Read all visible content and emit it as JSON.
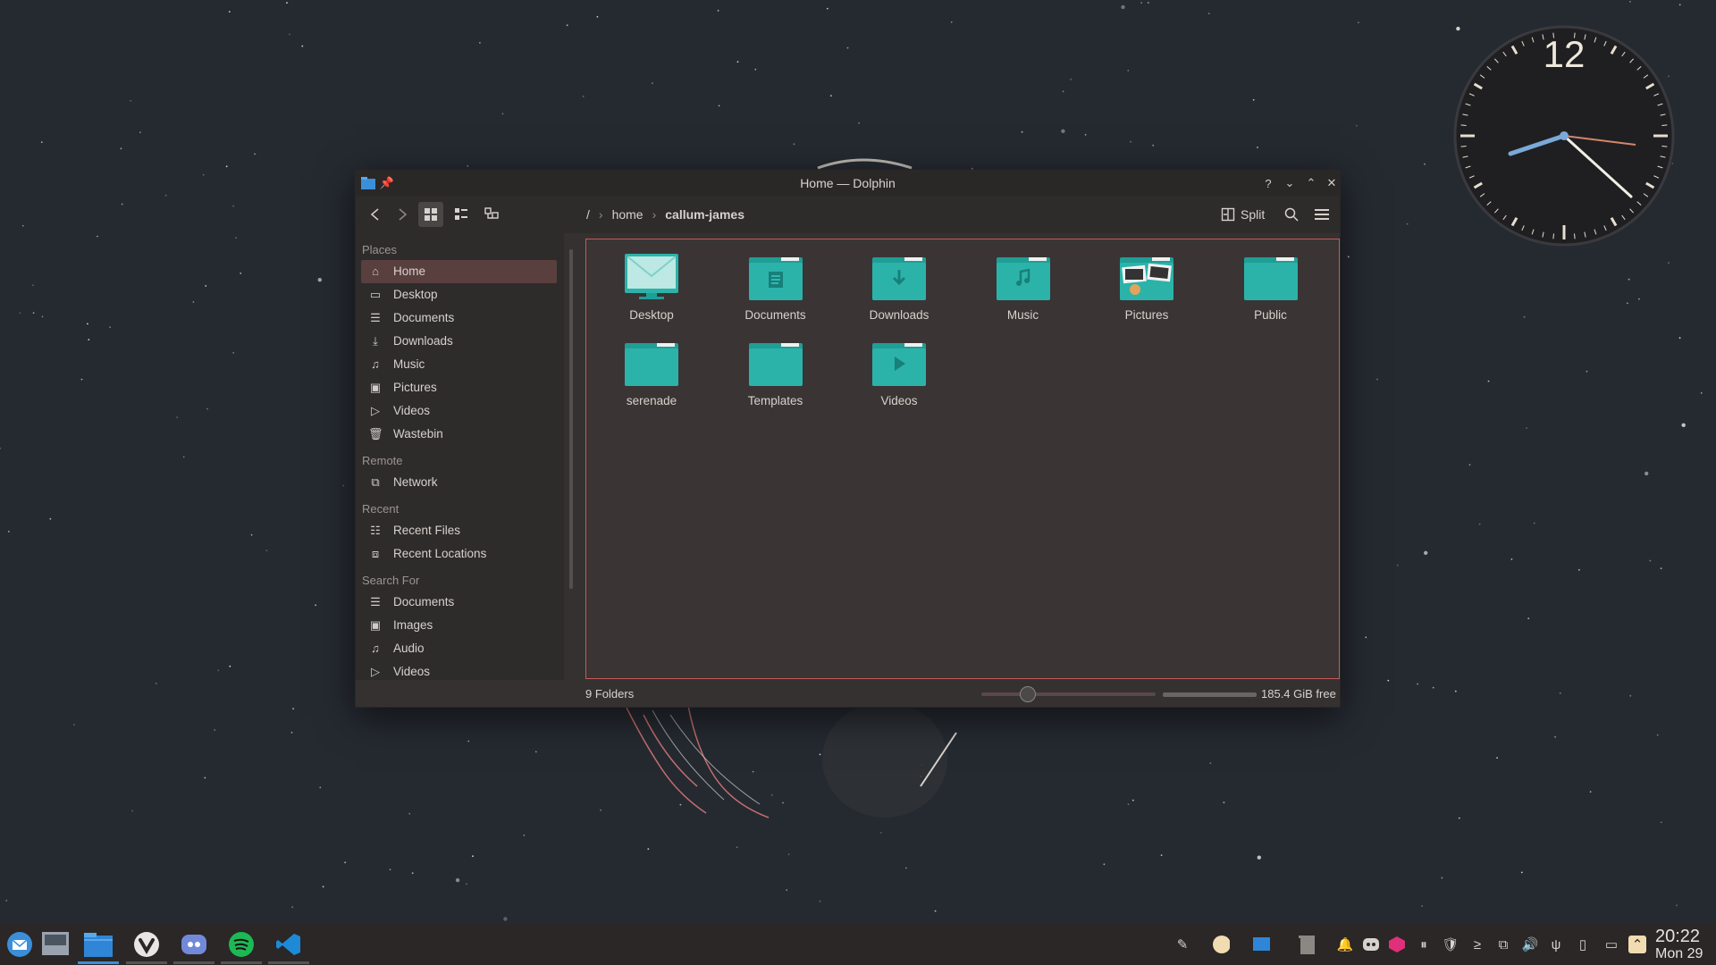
{
  "window": {
    "title": "Home — Dolphin",
    "split_label": "Split"
  },
  "breadcrumb": {
    "root": "/",
    "segments": [
      "home",
      "callum-james"
    ]
  },
  "sidebar": {
    "sections": [
      {
        "title": "Places",
        "items": [
          {
            "label": "Home",
            "icon": "home-icon",
            "active": true
          },
          {
            "label": "Desktop",
            "icon": "desktop-icon"
          },
          {
            "label": "Documents",
            "icon": "document-icon"
          },
          {
            "label": "Downloads",
            "icon": "download-icon"
          },
          {
            "label": "Music",
            "icon": "music-icon"
          },
          {
            "label": "Pictures",
            "icon": "image-icon"
          },
          {
            "label": "Videos",
            "icon": "play-icon"
          },
          {
            "label": "Wastebin",
            "icon": "trash-icon"
          }
        ]
      },
      {
        "title": "Remote",
        "items": [
          {
            "label": "Network",
            "icon": "network-icon"
          }
        ]
      },
      {
        "title": "Recent",
        "items": [
          {
            "label": "Recent Files",
            "icon": "recent-files-icon"
          },
          {
            "label": "Recent Locations",
            "icon": "recent-locations-icon"
          }
        ]
      },
      {
        "title": "Search For",
        "items": [
          {
            "label": "Documents",
            "icon": "document-icon"
          },
          {
            "label": "Images",
            "icon": "image-icon"
          },
          {
            "label": "Audio",
            "icon": "music-icon"
          },
          {
            "label": "Videos",
            "icon": "play-icon"
          }
        ]
      }
    ]
  },
  "folders": [
    {
      "label": "Desktop",
      "icon": "desktop-folder-icon"
    },
    {
      "label": "Documents",
      "icon": "documents-folder-icon"
    },
    {
      "label": "Downloads",
      "icon": "downloads-folder-icon"
    },
    {
      "label": "Music",
      "icon": "music-folder-icon"
    },
    {
      "label": "Pictures",
      "icon": "pictures-folder-icon"
    },
    {
      "label": "Public",
      "icon": "folder-icon"
    },
    {
      "label": "serenade",
      "icon": "folder-icon"
    },
    {
      "label": "Templates",
      "icon": "folder-icon"
    },
    {
      "label": "Videos",
      "icon": "videos-folder-icon"
    }
  ],
  "status": {
    "folder_count": "9 Folders",
    "free_space": "185.4 GiB free"
  },
  "clock": {
    "numeral": "12"
  },
  "taskbar": {
    "time": "20:22",
    "date": "Mon 29"
  },
  "colors": {
    "folder": "#1f9e96",
    "folder_light": "#2bb3aa",
    "accent_border": "#c45a5a",
    "active_place": "#5a3f3f"
  }
}
